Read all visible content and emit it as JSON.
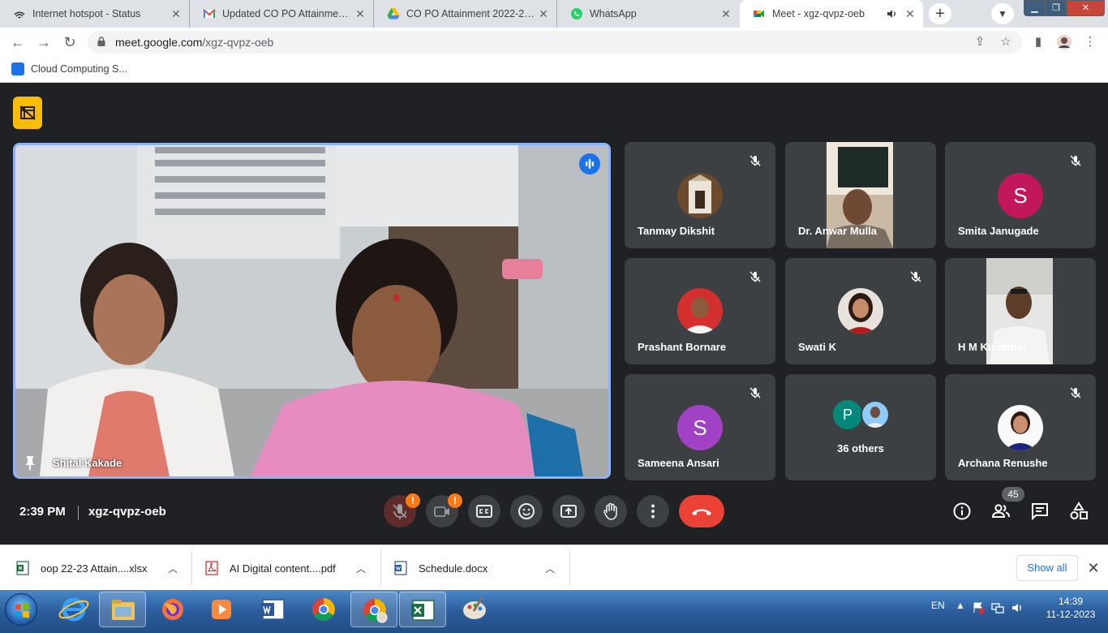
{
  "browser": {
    "tabs": [
      {
        "title": "Internet hotspot - Status",
        "icon": "hotspot-icon"
      },
      {
        "title": "Updated CO PO Attainment Sh",
        "icon": "gmail-icon"
      },
      {
        "title": "CO PO Attainment 2022-23 - G",
        "icon": "drive-icon"
      },
      {
        "title": "WhatsApp",
        "icon": "whatsapp-icon"
      },
      {
        "title": "Meet - xgz-qvpz-oeb",
        "icon": "meet-icon",
        "active": true
      }
    ],
    "url_host": "meet.google.com",
    "url_path": "/xgz-qvpz-oeb",
    "bookmark": "Cloud Computing S..."
  },
  "meet": {
    "pinned": {
      "name": "Shital Kakade"
    },
    "tiles": [
      {
        "name": "Tanmay Dikshit",
        "kind": "photo",
        "muted": true
      },
      {
        "name": "Dr. Anwar Mulla",
        "kind": "video",
        "muted": false
      },
      {
        "name": "Smita Janugade",
        "kind": "letter",
        "letter": "S",
        "color": "#c2185b",
        "muted": true
      },
      {
        "name": "Prashant Bornare",
        "kind": "photo",
        "muted": true
      },
      {
        "name": "Swati K",
        "kind": "photo",
        "muted": true
      },
      {
        "name": "H M Kumbhar",
        "kind": "video",
        "muted": false
      },
      {
        "name": "Sameena Ansari",
        "kind": "letter",
        "letter": "S",
        "color": "#a142c4",
        "muted": true
      },
      {
        "name": "36 others",
        "kind": "others",
        "letter": "P",
        "color": "#00897b",
        "muted": false
      },
      {
        "name": "Archana Renushe",
        "kind": "photo",
        "muted": true
      }
    ],
    "time": "2:39 PM",
    "meeting_code": "xgz-qvpz-oeb",
    "participant_count": "45",
    "alert_glyph": "!"
  },
  "downloads": {
    "items": [
      {
        "name": "oop 22-23 Attain....xlsx",
        "type": "excel"
      },
      {
        "name": "AI Digital content....pdf",
        "type": "pdf"
      },
      {
        "name": "Schedule.docx",
        "type": "word"
      }
    ],
    "show_all": "Show all"
  },
  "taskbar": {
    "lang": "EN",
    "time": "14:39",
    "date": "11-12-2023"
  },
  "colors": {
    "meet_bg": "#202124",
    "tile_bg": "#3c4043",
    "speaker_border": "#8ab4f8",
    "hangup": "#ea4335",
    "alert": "#fa7b17"
  }
}
